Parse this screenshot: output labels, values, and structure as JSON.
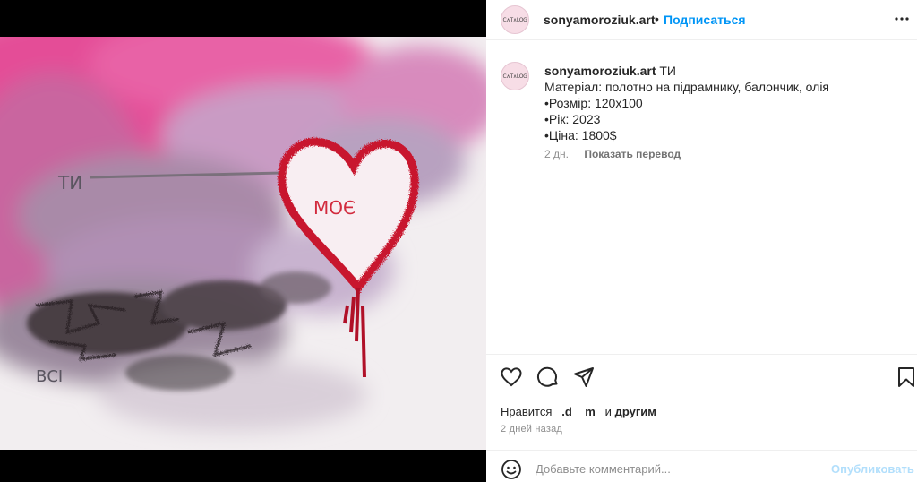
{
  "post": {
    "username": "sonyamoroziuk.art",
    "separator": "•",
    "follow_label": "Подписаться",
    "avatar_text": "C∧T∧LOG",
    "artwork": {
      "words": [
        "ТИ",
        "МОЄ",
        "ВСІ"
      ],
      "colors": {
        "pink": "#e2559b",
        "lavender": "#b98ab8",
        "heart": "#c8132d",
        "charcoal": "#3a3236"
      }
    }
  },
  "caption": {
    "username": "sonyamoroziuk.art",
    "title": "ТИ",
    "lines": [
      "Матеріал: полотно на підрамнику, балончик, олія",
      "•Розмір: 120х100",
      "•Рік: 2023",
      "•Ціна: 1800$"
    ],
    "age": "2 дн.",
    "translate_label": "Показать перевод"
  },
  "actions": {
    "icons": [
      "heart-icon",
      "comment-icon",
      "share-icon",
      "bookmark-icon"
    ],
    "likes_prefix": "Нравится",
    "likes_user": "_.d__m_",
    "likes_and": "и",
    "likes_others": "другим",
    "posted": "2 дней назад"
  },
  "comment": {
    "placeholder": "Добавьте комментарий...",
    "publish_label": "Опубликовать"
  },
  "colors": {
    "accent": "#0095f6",
    "publish_disabled": "#b2dffc",
    "muted": "#8e8e8e"
  }
}
